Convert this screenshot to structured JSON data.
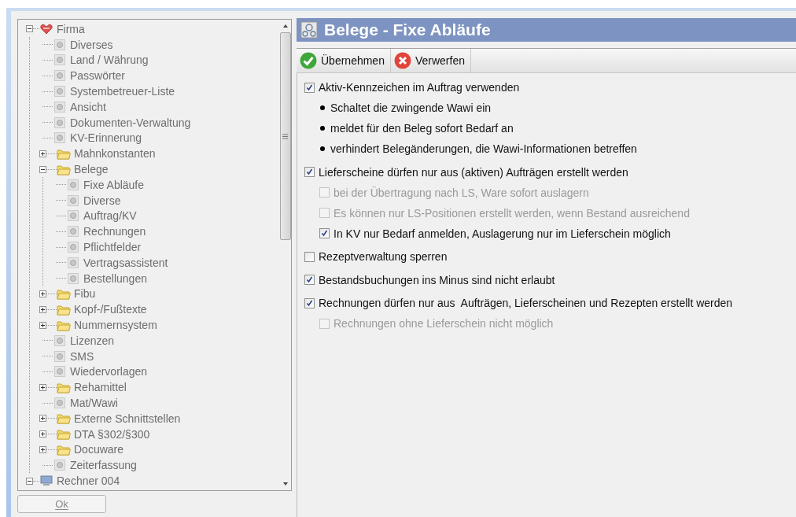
{
  "tree": [
    {
      "label": "Firma",
      "kind": "root",
      "expanded": true,
      "children": [
        {
          "label": "Diverses",
          "kind": "page"
        },
        {
          "label": "Land / Währung",
          "kind": "page"
        },
        {
          "label": "Passwörter",
          "kind": "page"
        },
        {
          "label": "Systembetreuer-Liste",
          "kind": "page"
        },
        {
          "label": "Ansicht",
          "kind": "page"
        },
        {
          "label": "Dokumenten-Verwaltung",
          "kind": "page"
        },
        {
          "label": "KV-Erinnerung",
          "kind": "page"
        },
        {
          "label": "Mahnkonstanten",
          "kind": "folder",
          "expanded": false
        },
        {
          "label": "Belege",
          "kind": "folder",
          "expanded": true,
          "children": [
            {
              "label": "Fixe Abläufe",
              "kind": "page"
            },
            {
              "label": "Diverse",
              "kind": "page"
            },
            {
              "label": "Auftrag/KV",
              "kind": "page"
            },
            {
              "label": "Rechnungen",
              "kind": "page"
            },
            {
              "label": "Pflichtfelder",
              "kind": "page"
            },
            {
              "label": "Vertragsassistent",
              "kind": "page"
            },
            {
              "label": "Bestellungen",
              "kind": "page"
            }
          ]
        },
        {
          "label": "Fibu",
          "kind": "folder",
          "expanded": false
        },
        {
          "label": "Kopf-/Fußtexte",
          "kind": "folder",
          "expanded": false
        },
        {
          "label": "Nummernsystem",
          "kind": "folder",
          "expanded": false
        },
        {
          "label": "Lizenzen",
          "kind": "page"
        },
        {
          "label": "SMS",
          "kind": "page"
        },
        {
          "label": "Wiedervorlagen",
          "kind": "page"
        },
        {
          "label": "Rehamittel",
          "kind": "folder",
          "expanded": false
        },
        {
          "label": "Mat/Wawi",
          "kind": "page"
        },
        {
          "label": "Externe Schnittstellen",
          "kind": "folder",
          "expanded": false
        },
        {
          "label": "DTA §302/§300",
          "kind": "folder",
          "expanded": false
        },
        {
          "label": "Docuware",
          "kind": "folder",
          "expanded": false
        },
        {
          "label": "Zeiterfassung",
          "kind": "page"
        }
      ]
    },
    {
      "label": "Rechner 004",
      "kind": "computer",
      "expanded": true
    }
  ],
  "ok_button": "Ok",
  "panel": {
    "title": "Belege - Fixe Abläufe",
    "toolbar": [
      {
        "label": "Übernehmen",
        "kind": "apply"
      },
      {
        "label": "Verwerfen",
        "kind": "discard"
      }
    ],
    "options": [
      {
        "kind": "checkbox",
        "label": "Aktiv-Kennzeichen im Auftrag verwenden",
        "checked": true,
        "disabled": false,
        "children": [
          {
            "kind": "bullet",
            "label": "Schaltet die zwingende Wawi ein"
          },
          {
            "kind": "bullet",
            "label": "meldet für den Beleg sofort Bedarf an"
          },
          {
            "kind": "bullet",
            "label": "verhindert Belegänderungen, die Wawi-Informationen betreffen"
          }
        ]
      },
      {
        "kind": "checkbox",
        "label": "Lieferscheine dürfen nur aus (aktiven) Aufträgen erstellt werden",
        "checked": true,
        "disabled": false,
        "children": [
          {
            "kind": "checkbox",
            "label": "bei der Übertragung nach LS, Ware sofort auslagern",
            "checked": false,
            "disabled": true
          },
          {
            "kind": "checkbox",
            "label": "Es können nur LS-Positionen erstellt werden, wenn Bestand ausreichend",
            "checked": false,
            "disabled": true
          },
          {
            "kind": "checkbox",
            "label": "In KV nur Bedarf anmelden, Auslagerung nur im Lieferschein möglich",
            "checked": true,
            "disabled": false
          }
        ]
      },
      {
        "kind": "checkbox",
        "label": "Rezeptverwaltung sperren",
        "checked": false,
        "disabled": false
      },
      {
        "kind": "checkbox",
        "label": "Bestandsbuchungen ins Minus sind nicht erlaubt",
        "checked": true,
        "disabled": false
      },
      {
        "kind": "checkbox",
        "label": "Rechnungen dürfen nur aus  Aufträgen, Lieferscheinen und Rezepten erstellt werden",
        "checked": true,
        "disabled": false,
        "children": [
          {
            "kind": "checkbox",
            "label": "Rechnungen ohne Lieferschein nicht möglich",
            "checked": false,
            "disabled": true
          }
        ]
      }
    ]
  }
}
